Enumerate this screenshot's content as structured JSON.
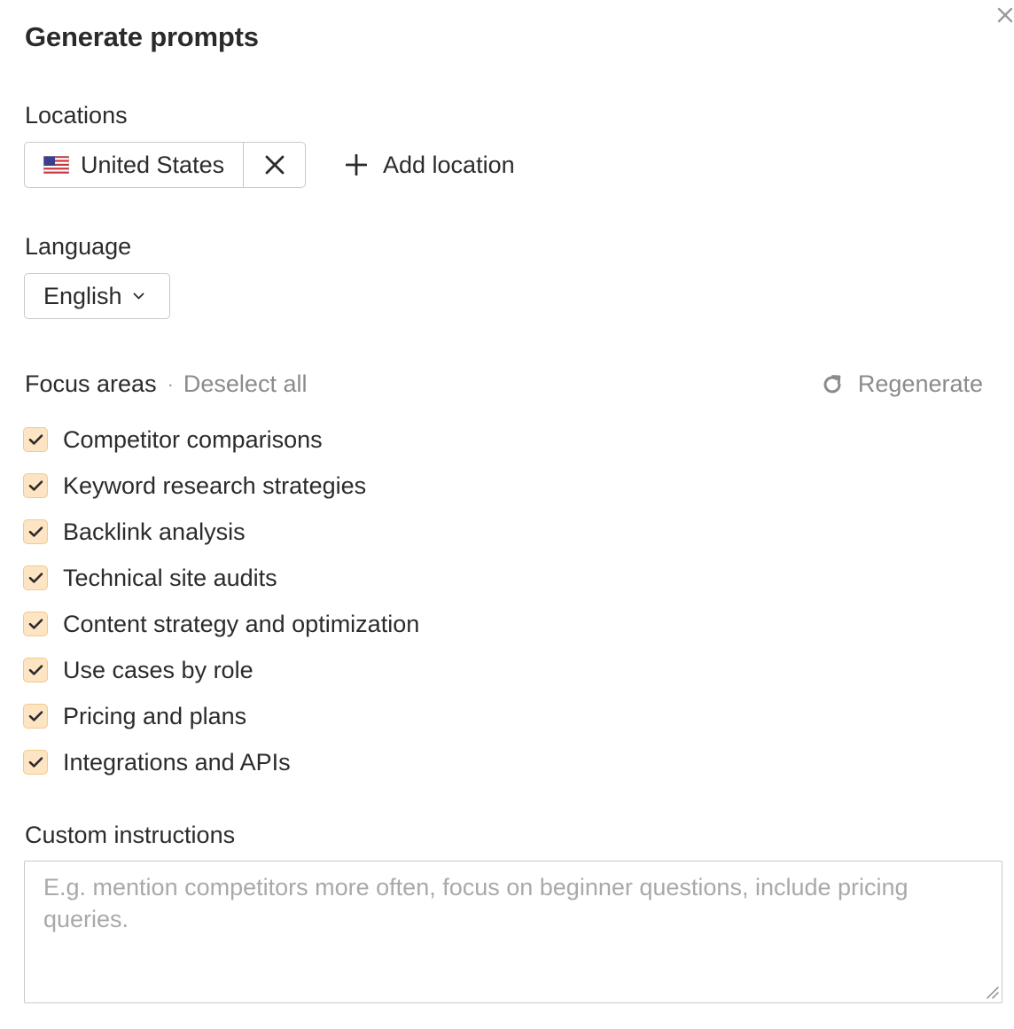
{
  "dialog": {
    "title": "Generate prompts",
    "close_icon": "close-icon"
  },
  "locations": {
    "label": "Locations",
    "selected": [
      {
        "name": "United States",
        "icon": "us-flag-icon"
      }
    ],
    "remove_icon": "close-icon",
    "add_label": "Add location",
    "add_icon": "plus-icon"
  },
  "language": {
    "label": "Language",
    "selected": "English",
    "icon": "chevron-down-icon"
  },
  "focus_areas": {
    "label": "Focus areas",
    "separator": "·",
    "deselect_label": "Deselect all",
    "regenerate_label": "Regenerate",
    "regenerate_icon": "refresh-icon",
    "checkbox_color": "#fde5c4",
    "items": [
      {
        "label": "Competitor comparisons",
        "checked": true
      },
      {
        "label": "Keyword research strategies",
        "checked": true
      },
      {
        "label": "Backlink analysis",
        "checked": true
      },
      {
        "label": "Technical site audits",
        "checked": true
      },
      {
        "label": "Content strategy and optimization",
        "checked": true
      },
      {
        "label": "Use cases by role",
        "checked": true
      },
      {
        "label": "Pricing and plans",
        "checked": true
      },
      {
        "label": "Integrations and APIs",
        "checked": true
      }
    ]
  },
  "custom_instructions": {
    "label": "Custom instructions",
    "value": "",
    "placeholder": "E.g. mention competitors more often, focus on beginner questions, include pricing queries."
  }
}
